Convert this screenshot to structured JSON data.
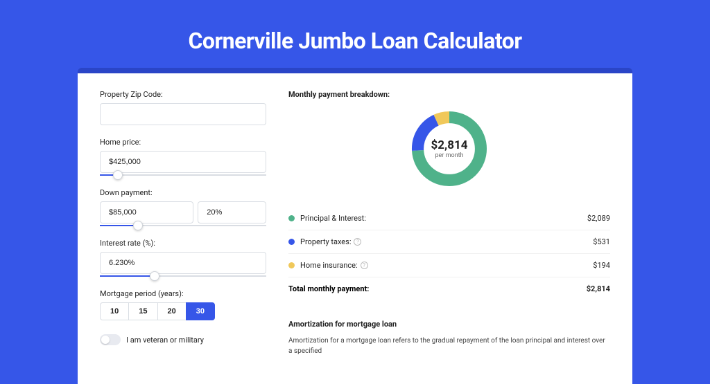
{
  "page": {
    "title": "Cornerville Jumbo Loan Calculator"
  },
  "fields": {
    "zip_label": "Property Zip Code:",
    "zip_value": "",
    "home_price_label": "Home price:",
    "home_price_value": "$425,000",
    "home_price_fill_pct": 8,
    "down_label": "Down payment:",
    "down_value": "$85,000",
    "down_pct": "20%",
    "down_fill_pct": 20,
    "rate_label": "Interest rate (%):",
    "rate_value": "6.230%",
    "rate_fill_pct": 30,
    "period_label": "Mortgage period (years):",
    "period_options": [
      "10",
      "15",
      "20",
      "30"
    ],
    "period_selected": "30",
    "veteran_label": "I am veteran or military"
  },
  "breakdown": {
    "title": "Monthly payment breakdown:",
    "center_amount": "$2,814",
    "center_sub": "per month",
    "items": [
      {
        "label": "Principal & Interest:",
        "value": "$2,089",
        "color": "#4fb28a",
        "info": false,
        "pct": 74
      },
      {
        "label": "Property taxes:",
        "value": "$531",
        "color": "#3656e8",
        "info": true,
        "pct": 19
      },
      {
        "label": "Home insurance:",
        "value": "$194",
        "color": "#f0c85a",
        "info": true,
        "pct": 7
      }
    ],
    "total_label": "Total monthly payment:",
    "total_value": "$2,814"
  },
  "amort": {
    "title": "Amortization for mortgage loan",
    "text": "Amortization for a mortgage loan refers to the gradual repayment of the loan principal and interest over a specified"
  },
  "chart_data": {
    "type": "pie",
    "title": "Monthly payment breakdown",
    "series": [
      {
        "name": "Principal & Interest",
        "value": 2089,
        "color": "#4fb28a"
      },
      {
        "name": "Property taxes",
        "value": 531,
        "color": "#3656e8"
      },
      {
        "name": "Home insurance",
        "value": 194,
        "color": "#f0c85a"
      }
    ],
    "total": 2814,
    "unit": "USD per month"
  }
}
